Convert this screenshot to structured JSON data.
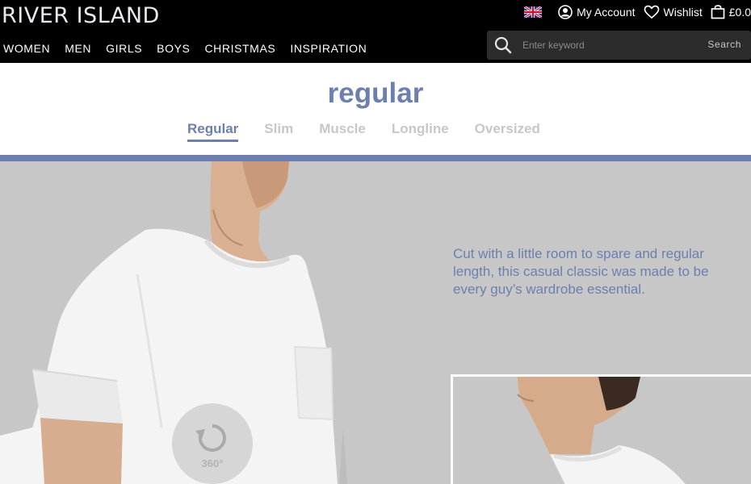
{
  "header": {
    "logo": "RIVER ISLAND",
    "utility": {
      "flag_icon": "uk-flag-icon",
      "account_label": "My Account",
      "wishlist_label": "Wishlist",
      "bag_label": "£0.0"
    },
    "nav": [
      "WOMEN",
      "MEN",
      "GIRLS",
      "BOYS",
      "CHRISTMAS",
      "INSPIRATION"
    ],
    "search": {
      "placeholder": "Enter keyword",
      "button_label": "Search"
    }
  },
  "page": {
    "title": "regular",
    "tabs": [
      {
        "label": "Regular",
        "active": true
      },
      {
        "label": "Slim",
        "active": false
      },
      {
        "label": "Muscle",
        "active": false
      },
      {
        "label": "Longline",
        "active": false
      },
      {
        "label": "Oversized",
        "active": false
      }
    ],
    "accent_color": "#6c7fae",
    "description": "Cut with a little room to spare and regular length, this casual classic was made to be every guy’s wardrobe essential.",
    "badge_360_label": "360°"
  }
}
